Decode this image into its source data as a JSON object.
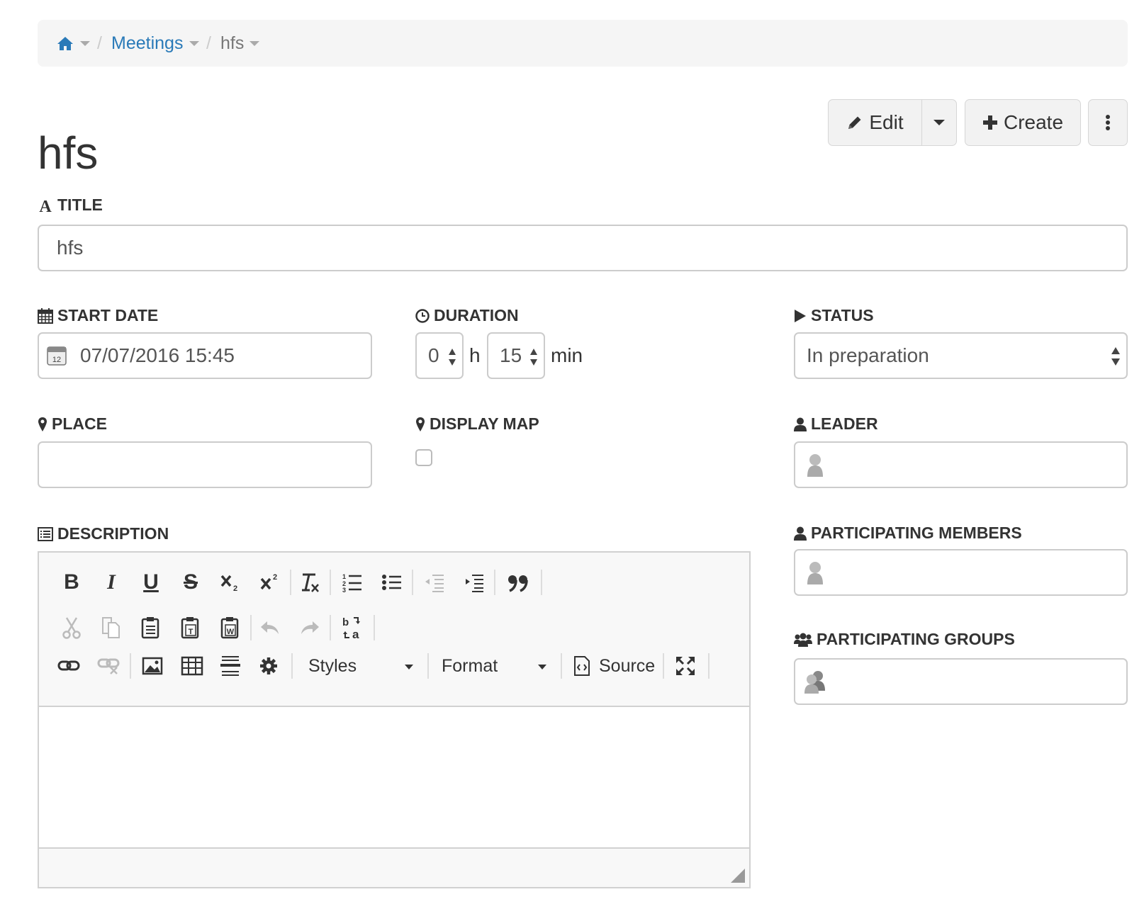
{
  "breadcrumb": {
    "home_icon": "home-icon",
    "items": [
      {
        "label": "Meetings"
      },
      {
        "label": "hfs"
      }
    ],
    "separator": "/"
  },
  "actions": {
    "edit_label": "Edit",
    "create_label": "Create"
  },
  "page": {
    "title": "hfs"
  },
  "fields": {
    "title": {
      "label": "TITLE",
      "value": "hfs"
    },
    "start_date": {
      "label": "START DATE",
      "value": "07/07/2016 15:45",
      "icon_day": "12"
    },
    "duration": {
      "label": "DURATION",
      "hours": "0",
      "hours_unit": "h",
      "minutes": "15",
      "minutes_unit": "min"
    },
    "status": {
      "label": "STATUS",
      "value": "In preparation"
    },
    "place": {
      "label": "PLACE",
      "value": ""
    },
    "display_map": {
      "label": "DISPLAY MAP",
      "checked": false
    },
    "leader": {
      "label": "LEADER"
    },
    "members": {
      "label": "PARTICIPATING MEMBERS"
    },
    "groups": {
      "label": "PARTICIPATING GROUPS"
    },
    "description": {
      "label": "DESCRIPTION"
    }
  },
  "editor": {
    "styles_label": "Styles",
    "format_label": "Format",
    "source_label": "Source",
    "toolbar_colors": {
      "active": "#333333",
      "disabled": "#bbbbbb"
    }
  },
  "colors": {
    "link": "#2a7ab8",
    "breadcrumb_bg": "#f5f5f5",
    "button_bg": "#f2f2f2"
  }
}
